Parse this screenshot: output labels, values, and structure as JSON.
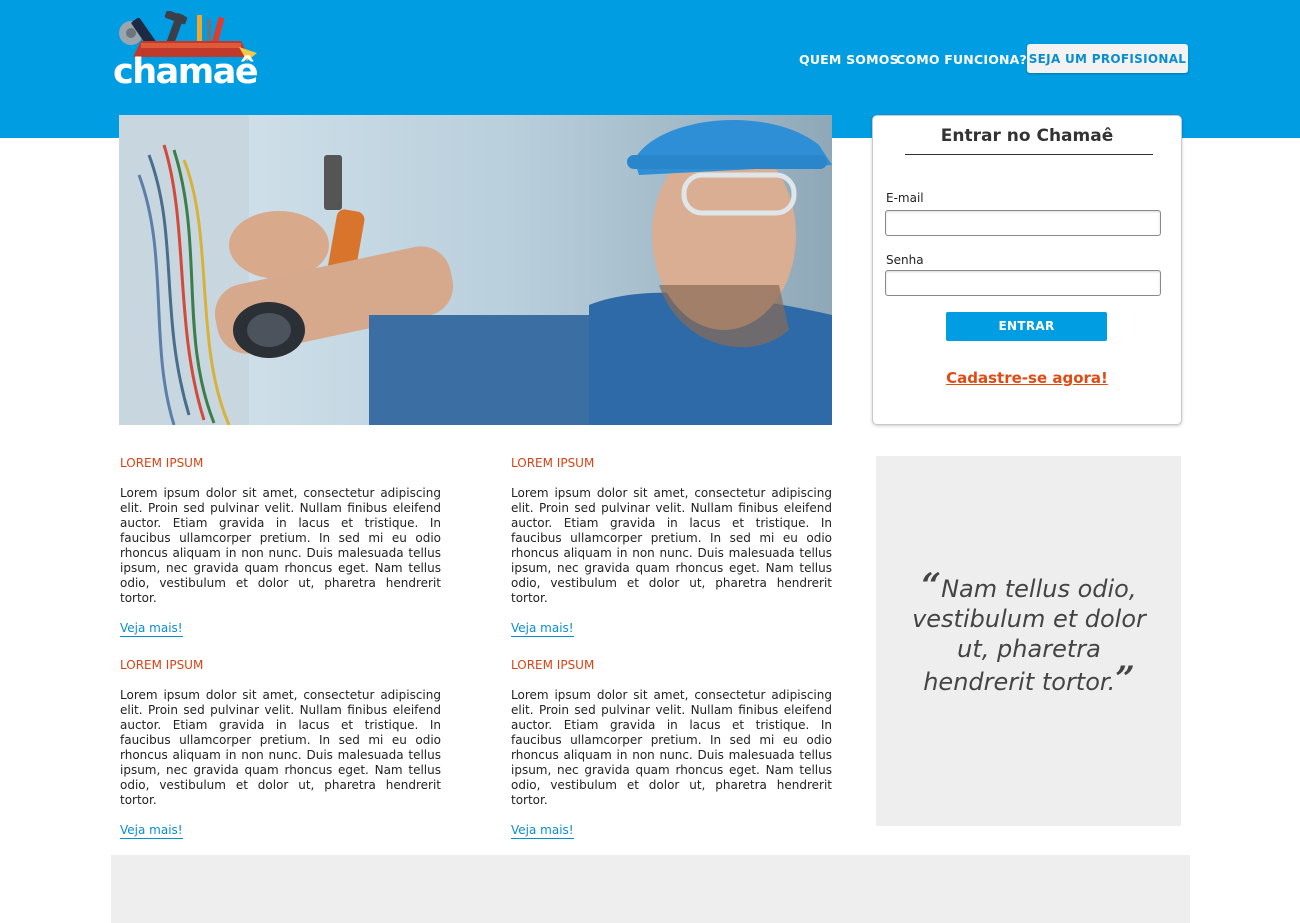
{
  "header": {
    "logo_text": "chamaê",
    "nav": [
      "QUEM SOMOS",
      "COMO FUNCIONA?"
    ],
    "cta_label": "SEJA UM PROFISIONAL"
  },
  "login": {
    "title": "Entrar no Chamaê",
    "email_label": "E-mail",
    "email_value": "",
    "senha_label": "Senha",
    "senha_value": "",
    "submit_label": "ENTRAR",
    "signup_label": "Cadastre-se agora!"
  },
  "articles": [
    {
      "title": "LOREM IPSUM",
      "body": "Lorem ipsum dolor sit amet, consectetur adipiscing elit. Proin sed pulvinar velit. Nullam finibus eleifend auctor. Etiam gravida in lacus et tristique. In faucibus ullamcorper pretium. In sed mi eu odio rhoncus aliquam in non nunc. Duis malesuada tellus ipsum, nec gravida quam rhoncus eget. Nam tellus odio, vestibulum et dolor ut, pharetra hendrerit tortor.",
      "link": "Veja mais!"
    },
    {
      "title": "LOREM IPSUM",
      "body": "Lorem ipsum dolor sit amet, consectetur adipiscing elit. Proin sed pulvinar velit. Nullam finibus eleifend auctor. Etiam gravida in lacus et tristique. In faucibus ullamcorper pretium. In sed mi eu odio rhoncus aliquam in non nunc. Duis malesuada tellus ipsum, nec gravida quam rhoncus eget. Nam tellus odio, vestibulum et dolor ut, pharetra hendrerit tortor.",
      "link": "Veja mais!"
    },
    {
      "title": "LOREM IPSUM",
      "body": "Lorem ipsum dolor sit amet, consectetur adipiscing elit. Proin sed pulvinar velit. Nullam finibus eleifend auctor. Etiam gravida in lacus et tristique. In faucibus ullamcorper pretium. In sed mi eu odio rhoncus aliquam in non nunc. Duis malesuada tellus ipsum, nec gravida quam rhoncus eget. Nam tellus odio, vestibulum et dolor ut, pharetra hendrerit tortor.",
      "link": "Veja mais!"
    },
    {
      "title": "LOREM IPSUM",
      "body": "Lorem ipsum dolor sit amet, consectetur adipiscing elit. Proin sed pulvinar velit. Nullam finibus eleifend auctor. Etiam gravida in lacus et tristique. In faucibus ullamcorper pretium. In sed mi eu odio rhoncus aliquam in non nunc. Duis malesuada tellus ipsum, nec gravida quam rhoncus eget. Nam tellus odio, vestibulum et dolor ut, pharetra hendrerit tortor.",
      "link": "Veja mais!"
    }
  ],
  "quote": {
    "open_mark": "“",
    "text": "Nam tellus odio, vestibulum et dolor ut, pharetra hendrerit tortor.",
    "close_mark": "”"
  },
  "colors": {
    "brand_blue": "#009de3",
    "accent_orange": "#d84315",
    "link_blue": "#0a8dd0",
    "panel_gray": "#eeeeee"
  },
  "icons": {
    "logo": "toolbox-tools-logo",
    "hero": "electrician-photo"
  }
}
